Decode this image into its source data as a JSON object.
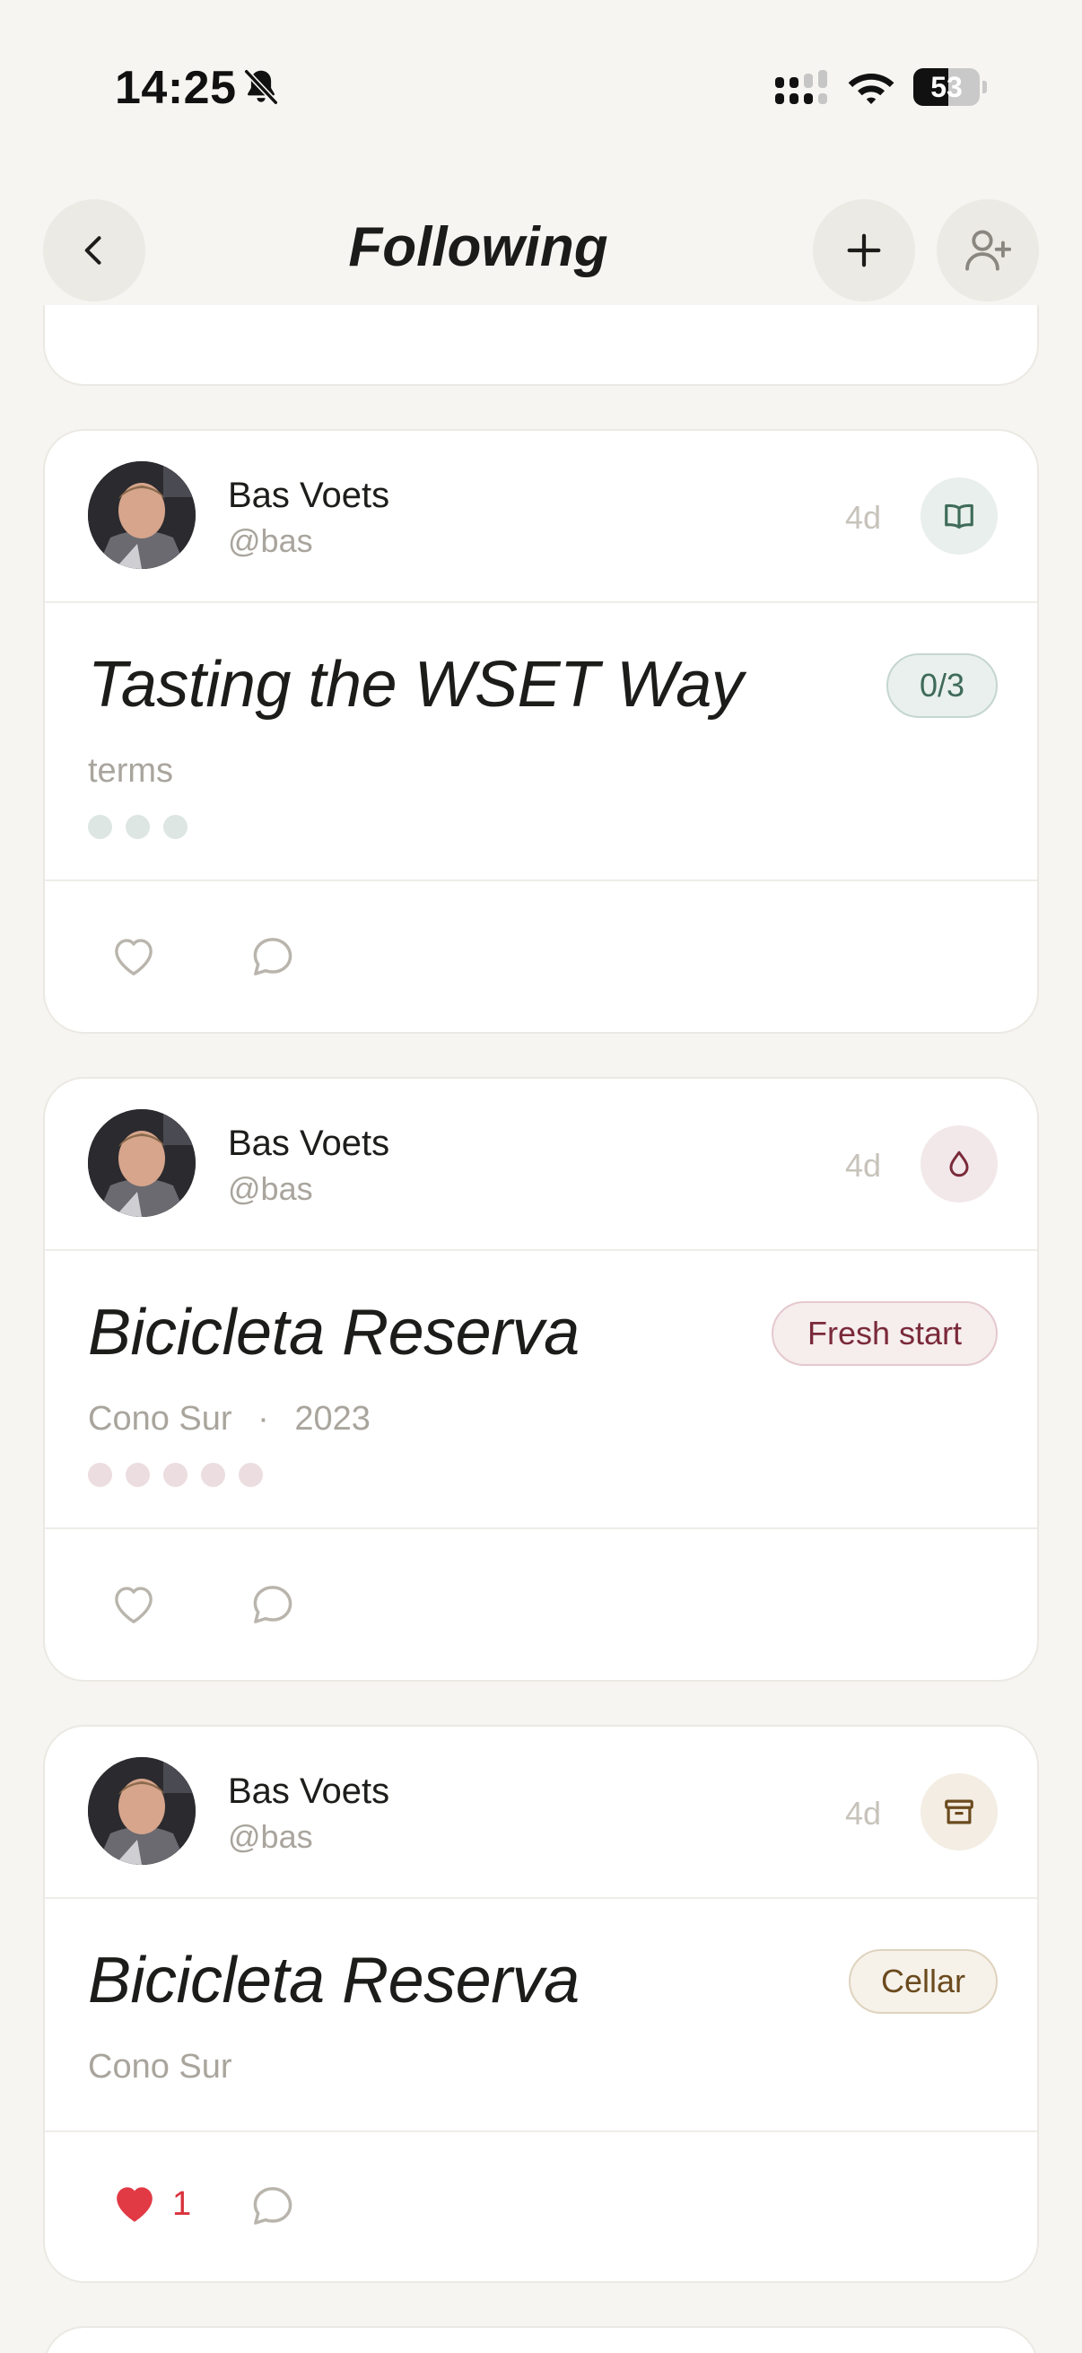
{
  "status_bar": {
    "time": "14:25",
    "battery": "53",
    "battery_level": 0.53
  },
  "header": {
    "title": "Following"
  },
  "feed": [
    {
      "user": {
        "name": "Bas Voets",
        "handle": "@bas"
      },
      "time_ago": "4d",
      "type_icon": "book-icon",
      "title": "Tasting the WSET Way",
      "subtitle": "terms",
      "badge": "0/3",
      "dots": 3,
      "likes": "",
      "liked": false
    },
    {
      "user": {
        "name": "Bas Voets",
        "handle": "@bas"
      },
      "time_ago": "4d",
      "type_icon": "drop-icon",
      "title": "Bicicleta Reserva",
      "subtitle_parts": [
        "Cono Sur",
        "·",
        "2023"
      ],
      "badge": "Fresh start",
      "dots": 5,
      "likes": "",
      "liked": false
    },
    {
      "user": {
        "name": "Bas Voets",
        "handle": "@bas"
      },
      "time_ago": "4d",
      "type_icon": "archive-box-icon",
      "title": "Bicicleta Reserva",
      "subtitle": "Cono Sur",
      "badge": "Cellar",
      "likes": "1",
      "liked": true
    }
  ],
  "colors": {
    "background": "#f6f5f1",
    "like_red": "#e23a45",
    "study_green": "#3f6b5a",
    "wine_maroon": "#7a2a3a",
    "cellar_brown": "#6b4a1e"
  }
}
